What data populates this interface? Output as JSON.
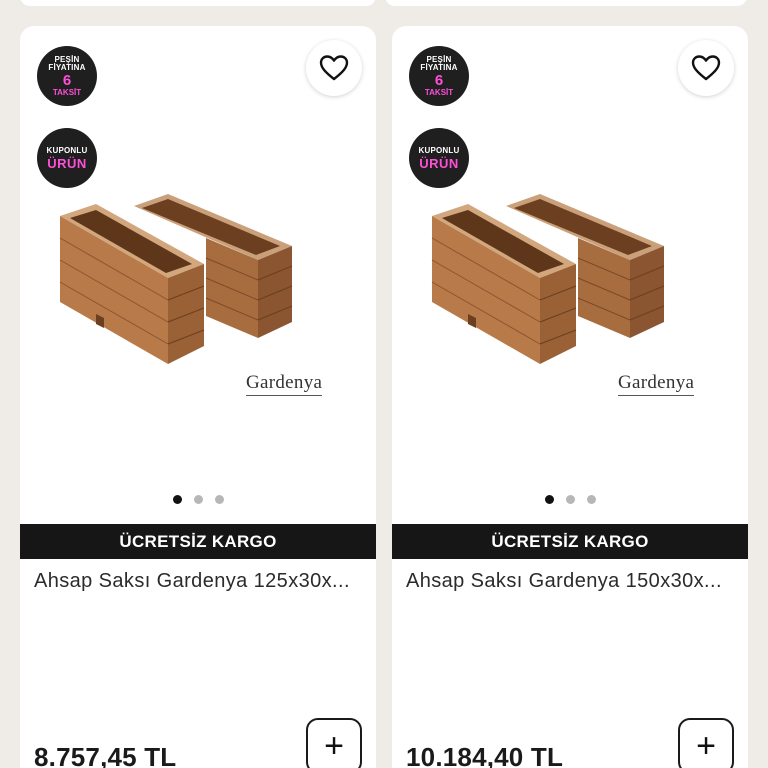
{
  "products": [
    {
      "badge_taksit": {
        "line1": "PEŞİN",
        "line2": "FİYATINA",
        "number": "6",
        "line3": "TAKSİT"
      },
      "badge_kupon": {
        "line1": "KUPONLU",
        "line2": "ÜRÜN"
      },
      "brand_mark": "Gardenya",
      "shipping": "ÜCRETSİZ KARGO",
      "title": "Ahsap Saksı Gardenya 125x30x...",
      "price": "8.757,45 TL",
      "add_label": "+",
      "carousel_total": 3,
      "carousel_active": 1
    },
    {
      "badge_taksit": {
        "line1": "PEŞİN",
        "line2": "FİYATINA",
        "number": "6",
        "line3": "TAKSİT"
      },
      "badge_kupon": {
        "line1": "KUPONLU",
        "line2": "ÜRÜN"
      },
      "brand_mark": "Gardenya",
      "shipping": "ÜCRETSİZ KARGO",
      "title": "Ahsap Saksı Gardenya 150x30x...",
      "price": "10.184,40 TL",
      "add_label": "+",
      "carousel_total": 3,
      "carousel_active": 1
    }
  ],
  "icons": {
    "favorite": "heart-outline-icon",
    "add": "plus-icon"
  },
  "colors": {
    "background": "#efebe7",
    "badge": "#1f1f1f",
    "badge_accent": "#ff4fd8",
    "shipping_bar": "#161616"
  }
}
